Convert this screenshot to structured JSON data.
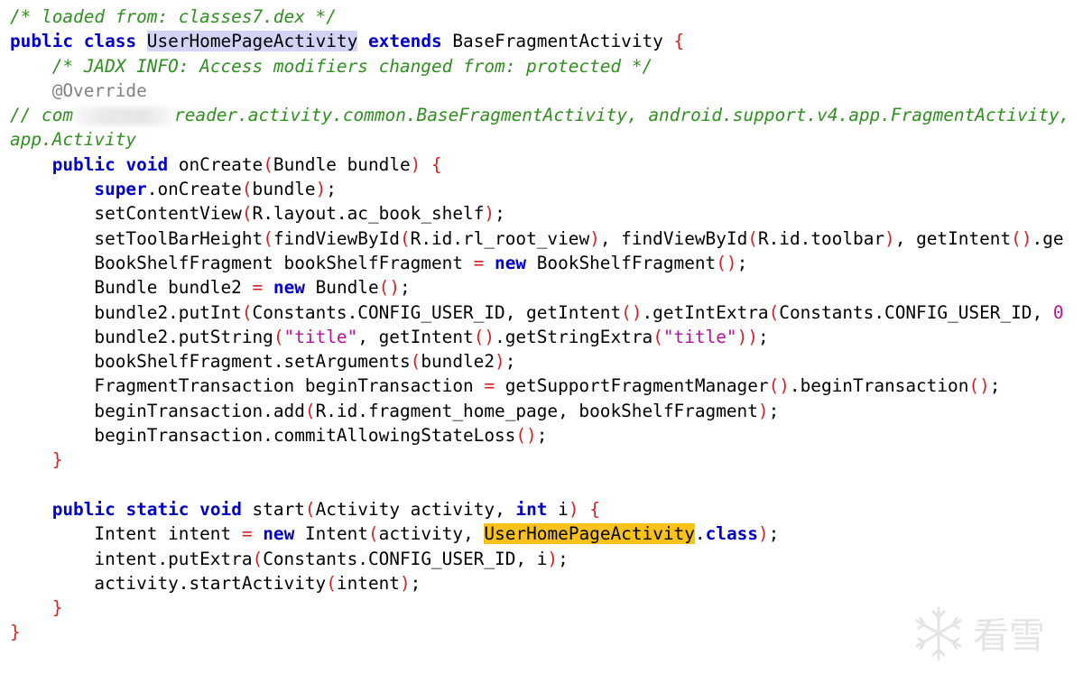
{
  "editor": {
    "language": "java",
    "lines": [
      [
        {
          "t": "/* loaded from: classes7.dex */",
          "c": "cmt"
        }
      ],
      [
        {
          "t": "public",
          "c": "kw"
        },
        {
          "t": " "
        },
        {
          "t": "class",
          "c": "kw"
        },
        {
          "t": " "
        },
        {
          "t": "UserHomePageActivity",
          "c": "hl1"
        },
        {
          "t": " "
        },
        {
          "t": "extends",
          "c": "kw"
        },
        {
          "t": " BaseFragmentActivity "
        },
        {
          "t": "{",
          "c": "pun"
        }
      ],
      [
        {
          "t": "    "
        },
        {
          "t": "/* JADX INFO: Access modifiers changed from: protected */",
          "c": "cmt"
        }
      ],
      [
        {
          "t": "    "
        },
        {
          "t": "@Override",
          "c": "anno"
        }
      ],
      [
        {
          "t": "// com",
          "c": "cmt"
        },
        {
          "t": "",
          "c": "blur"
        },
        {
          "t": "reader.activity.common.BaseFragmentActivity, android.support.v4.app.FragmentActivity, ",
          "c": "cmt"
        }
      ],
      [
        {
          "t": "app.Activity",
          "c": "cmt"
        }
      ],
      [
        {
          "t": "    "
        },
        {
          "t": "public",
          "c": "kw"
        },
        {
          "t": " "
        },
        {
          "t": "void",
          "c": "kw"
        },
        {
          "t": " onCreate"
        },
        {
          "t": "(",
          "c": "pun"
        },
        {
          "t": "Bundle bundle"
        },
        {
          "t": ")",
          "c": "pun"
        },
        {
          "t": " "
        },
        {
          "t": "{",
          "c": "pun"
        }
      ],
      [
        {
          "t": "        "
        },
        {
          "t": "super",
          "c": "kw"
        },
        {
          "t": ".onCreate"
        },
        {
          "t": "(",
          "c": "pun"
        },
        {
          "t": "bundle"
        },
        {
          "t": ")",
          "c": "pun"
        },
        {
          "t": ";"
        }
      ],
      [
        {
          "t": "        setContentView"
        },
        {
          "t": "(",
          "c": "pun"
        },
        {
          "t": "R.layout.ac_book_shelf"
        },
        {
          "t": ")",
          "c": "pun"
        },
        {
          "t": ";"
        }
      ],
      [
        {
          "t": "        setToolBarHeight"
        },
        {
          "t": "(",
          "c": "pun"
        },
        {
          "t": "findViewById"
        },
        {
          "t": "(",
          "c": "pun"
        },
        {
          "t": "R.id.rl_root_view"
        },
        {
          "t": ")",
          "c": "pun"
        },
        {
          "t": ", findViewById"
        },
        {
          "t": "(",
          "c": "pun"
        },
        {
          "t": "R.id.toolbar"
        },
        {
          "t": ")",
          "c": "pun"
        },
        {
          "t": ", getIntent"
        },
        {
          "t": "()",
          "c": "pun"
        },
        {
          "t": ".ge"
        }
      ],
      [
        {
          "t": "        BookShelfFragment bookShelfFragment "
        },
        {
          "t": "=",
          "c": "pun"
        },
        {
          "t": " "
        },
        {
          "t": "new",
          "c": "kw"
        },
        {
          "t": " BookShelfFragment"
        },
        {
          "t": "()",
          "c": "pun"
        },
        {
          "t": ";"
        }
      ],
      [
        {
          "t": "        Bundle bundle2 "
        },
        {
          "t": "=",
          "c": "pun"
        },
        {
          "t": " "
        },
        {
          "t": "new",
          "c": "kw"
        },
        {
          "t": " Bundle"
        },
        {
          "t": "()",
          "c": "pun"
        },
        {
          "t": ";"
        }
      ],
      [
        {
          "t": "        bundle2.putInt"
        },
        {
          "t": "(",
          "c": "pun"
        },
        {
          "t": "Constants.CONFIG_USER_ID, getIntent"
        },
        {
          "t": "()",
          "c": "pun"
        },
        {
          "t": ".getIntExtra"
        },
        {
          "t": "(",
          "c": "pun"
        },
        {
          "t": "Constants.CONFIG_USER_ID, "
        },
        {
          "t": "0",
          "c": "str"
        }
      ],
      [
        {
          "t": "        bundle2.putString"
        },
        {
          "t": "(",
          "c": "pun"
        },
        {
          "t": "\"title\"",
          "c": "str"
        },
        {
          "t": ", getIntent"
        },
        {
          "t": "()",
          "c": "pun"
        },
        {
          "t": ".getStringExtra"
        },
        {
          "t": "(",
          "c": "pun"
        },
        {
          "t": "\"title\"",
          "c": "str"
        },
        {
          "t": "))",
          "c": "pun"
        },
        {
          "t": ";"
        }
      ],
      [
        {
          "t": "        bookShelfFragment.setArguments"
        },
        {
          "t": "(",
          "c": "pun"
        },
        {
          "t": "bundle2"
        },
        {
          "t": ")",
          "c": "pun"
        },
        {
          "t": ";"
        }
      ],
      [
        {
          "t": "        FragmentTransaction beginTransaction "
        },
        {
          "t": "=",
          "c": "pun"
        },
        {
          "t": " getSupportFragmentManager"
        },
        {
          "t": "()",
          "c": "pun"
        },
        {
          "t": ".beginTransaction"
        },
        {
          "t": "()",
          "c": "pun"
        },
        {
          "t": ";"
        }
      ],
      [
        {
          "t": "        beginTransaction.add"
        },
        {
          "t": "(",
          "c": "pun"
        },
        {
          "t": "R.id.fragment_home_page, bookShelfFragment"
        },
        {
          "t": ")",
          "c": "pun"
        },
        {
          "t": ";"
        }
      ],
      [
        {
          "t": "        beginTransaction.commitAllowingStateLoss"
        },
        {
          "t": "()",
          "c": "pun"
        },
        {
          "t": ";"
        }
      ],
      [
        {
          "t": "    "
        },
        {
          "t": "}",
          "c": "pun"
        }
      ],
      [
        {
          "t": ""
        }
      ],
      [
        {
          "t": "    "
        },
        {
          "t": "public",
          "c": "kw"
        },
        {
          "t": " "
        },
        {
          "t": "static",
          "c": "kw"
        },
        {
          "t": " "
        },
        {
          "t": "void",
          "c": "kw"
        },
        {
          "t": " start"
        },
        {
          "t": "(",
          "c": "pun"
        },
        {
          "t": "Activity activity, "
        },
        {
          "t": "int",
          "c": "kw"
        },
        {
          "t": " i"
        },
        {
          "t": ")",
          "c": "pun"
        },
        {
          "t": " "
        },
        {
          "t": "{",
          "c": "pun"
        }
      ],
      [
        {
          "t": "        Intent intent "
        },
        {
          "t": "=",
          "c": "pun"
        },
        {
          "t": " "
        },
        {
          "t": "new",
          "c": "kw"
        },
        {
          "t": " Intent"
        },
        {
          "t": "(",
          "c": "pun"
        },
        {
          "t": "activity, "
        },
        {
          "t": "UserHomePageActivity",
          "c": "hl2"
        },
        {
          "t": "."
        },
        {
          "t": "class",
          "c": "kw"
        },
        {
          "t": ")",
          "c": "pun"
        },
        {
          "t": ";"
        }
      ],
      [
        {
          "t": "        intent.putExtra"
        },
        {
          "t": "(",
          "c": "pun"
        },
        {
          "t": "Constants.CONFIG_USER_ID, i"
        },
        {
          "t": ")",
          "c": "pun"
        },
        {
          "t": ";"
        }
      ],
      [
        {
          "t": "        activity.startActivity"
        },
        {
          "t": "(",
          "c": "pun"
        },
        {
          "t": "intent"
        },
        {
          "t": ")",
          "c": "pun"
        },
        {
          "t": ";"
        }
      ],
      [
        {
          "t": "    "
        },
        {
          "t": "}",
          "c": "pun"
        }
      ],
      [
        {
          "t": "}",
          "c": "pun"
        }
      ]
    ]
  },
  "watermark": {
    "text": "看雪",
    "icon": "snowflake-icon"
  }
}
